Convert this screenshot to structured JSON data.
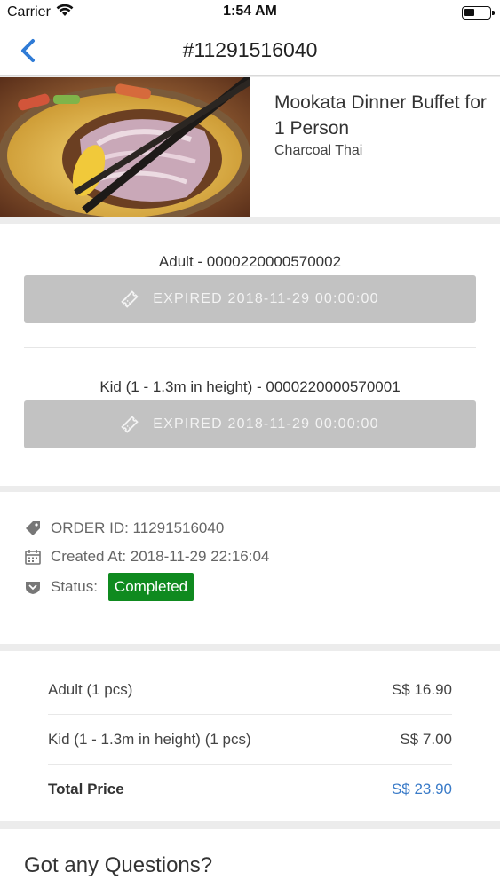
{
  "status_bar": {
    "carrier": "Carrier",
    "time": "1:54 AM",
    "battery_level": 0.4
  },
  "nav": {
    "title": "#11291516040",
    "back_icon": "chevron-left-icon",
    "accent_color": "#2f7bd6"
  },
  "product": {
    "name": "Mookata Dinner Buffet for 1 Person",
    "merchant": "Charcoal Thai"
  },
  "vouchers": [
    {
      "label": "Adult - 0000220000570002",
      "button_text": "EXPIRED 2018-11-29 00:00:00",
      "icon": "ticket-icon"
    },
    {
      "label": "Kid (1 - 1.3m in height) - 0000220000570001",
      "button_text": "EXPIRED 2018-11-29 00:00:00",
      "icon": "ticket-icon"
    }
  ],
  "order": {
    "order_id": "ORDER ID: 11291516040",
    "created_at": "Created At: 2018-11-29 22:16:04",
    "status_label": "Status:",
    "status_value": "Completed",
    "status_color": "#0f8a1f"
  },
  "prices": {
    "items": [
      {
        "label": "Adult (1 pcs)",
        "value": "S$ 16.90"
      },
      {
        "label": "Kid (1 - 1.3m in height) (1 pcs)",
        "value": "S$ 7.00"
      }
    ],
    "total_label": "Total Price",
    "total_value": "S$ 23.90",
    "total_color": "#3a7bc8"
  },
  "questions": {
    "title": "Got any Questions?"
  }
}
